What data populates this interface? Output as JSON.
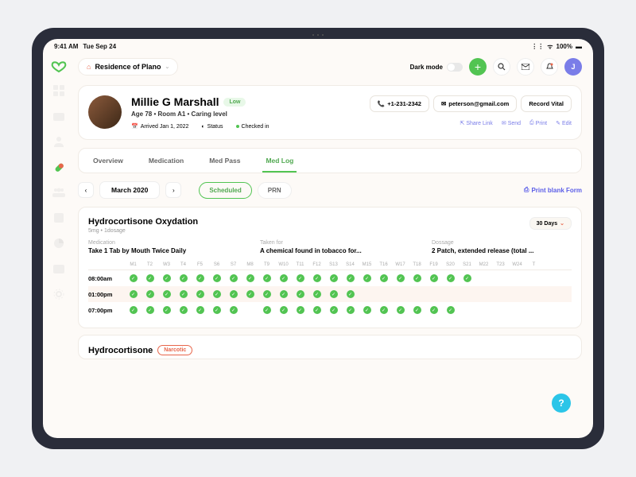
{
  "statusbar": {
    "time": "9:41 AM",
    "date": "Tue Sep 24",
    "wifi": "100%"
  },
  "location": {
    "label": "Residence of Plano"
  },
  "darkmode": {
    "label": "Dark mode"
  },
  "userInitial": "J",
  "patient": {
    "name": "Millie G Marshall",
    "risk": "Low",
    "meta": "Age 78   •   Room A1   •   Caring level",
    "arrived_label": "Arrived Jan 1, 2022",
    "status_label": "Status",
    "status_value": "Checked in",
    "phone": "+1-231-2342",
    "email": "peterson@gmail.com",
    "record_vital": "Record Vital",
    "links": {
      "share": "Share Link",
      "send": "Send",
      "print": "Print",
      "edit": "Edit"
    }
  },
  "tabs": [
    "Overview",
    "Medication",
    "Med Pass",
    "Med Log"
  ],
  "activeTab": 3,
  "filters": {
    "month": "March 2020",
    "scheduled": "Scheduled",
    "prn": "PRN",
    "print": "Print blank Form"
  },
  "medication": {
    "title": "Hydrocortisone Oxydation",
    "sub": "5mg  •  1dosage",
    "duration": "30 Days",
    "cols": {
      "medication": {
        "label": "Medication",
        "value": "Take 1 Tab by Mouth Twice Daily"
      },
      "taken": {
        "label": "Taken for",
        "value": "A chemical found in tobacco for..."
      },
      "dosage": {
        "label": "Dossage",
        "value": "2 Patch, extended release (total ..."
      }
    },
    "days": [
      "M1",
      "T2",
      "W3",
      "T4",
      "F5",
      "S6",
      "S7",
      "M8",
      "T9",
      "W10",
      "T11",
      "F12",
      "S13",
      "S14",
      "M15",
      "T16",
      "W17",
      "T18",
      "F19",
      "S20",
      "S21",
      "M22",
      "T23",
      "W24",
      "T"
    ],
    "rows": [
      {
        "time": "08:00am",
        "checks": [
          1,
          1,
          1,
          1,
          1,
          1,
          1,
          1,
          1,
          1,
          1,
          1,
          1,
          1,
          1,
          1,
          1,
          1,
          1,
          1,
          1,
          0,
          0,
          0,
          0
        ]
      },
      {
        "time": "01:00pm",
        "checks": [
          1,
          1,
          1,
          1,
          1,
          1,
          1,
          1,
          1,
          1,
          1,
          1,
          1,
          1,
          0,
          0,
          0,
          0,
          0,
          0,
          0,
          0,
          0,
          0,
          0
        ]
      },
      {
        "time": "07:00pm",
        "checks": [
          1,
          1,
          1,
          1,
          1,
          1,
          1,
          0,
          1,
          1,
          1,
          1,
          1,
          1,
          1,
          1,
          1,
          1,
          1,
          1,
          0,
          0,
          0,
          0,
          0
        ]
      }
    ]
  },
  "medication2": {
    "title": "Hydrocortisone",
    "badge": "Narcotic"
  }
}
